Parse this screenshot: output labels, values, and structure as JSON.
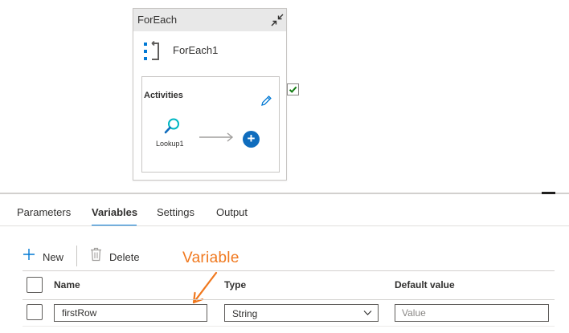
{
  "canvas": {
    "foreach": {
      "title": "ForEach",
      "name": "ForEach1",
      "activities_label": "Activities",
      "lookup_label": "Lookup1",
      "add_symbol": "+"
    },
    "icons": [
      "collapse-icon",
      "foreach-icon",
      "edit-pencil-icon",
      "lookup-icon",
      "add-icon",
      "check-icon"
    ]
  },
  "tabs": [
    {
      "label": "Parameters",
      "active": false
    },
    {
      "label": "Variables",
      "active": true
    },
    {
      "label": "Settings",
      "active": false
    },
    {
      "label": "Output",
      "active": false
    }
  ],
  "toolbar": {
    "new_label": "New",
    "delete_label": "Delete"
  },
  "annotation": {
    "text": "Variable",
    "color": "#f0781e"
  },
  "table": {
    "columns": [
      "Name",
      "Type",
      "Default value"
    ],
    "rows": [
      {
        "name": "firstRow",
        "type": "String",
        "default_placeholder": "Value",
        "checked": false
      }
    ]
  },
  "colors": {
    "accent": "#0078d4",
    "add_button": "#0f6cbd",
    "check": "#107c10"
  }
}
